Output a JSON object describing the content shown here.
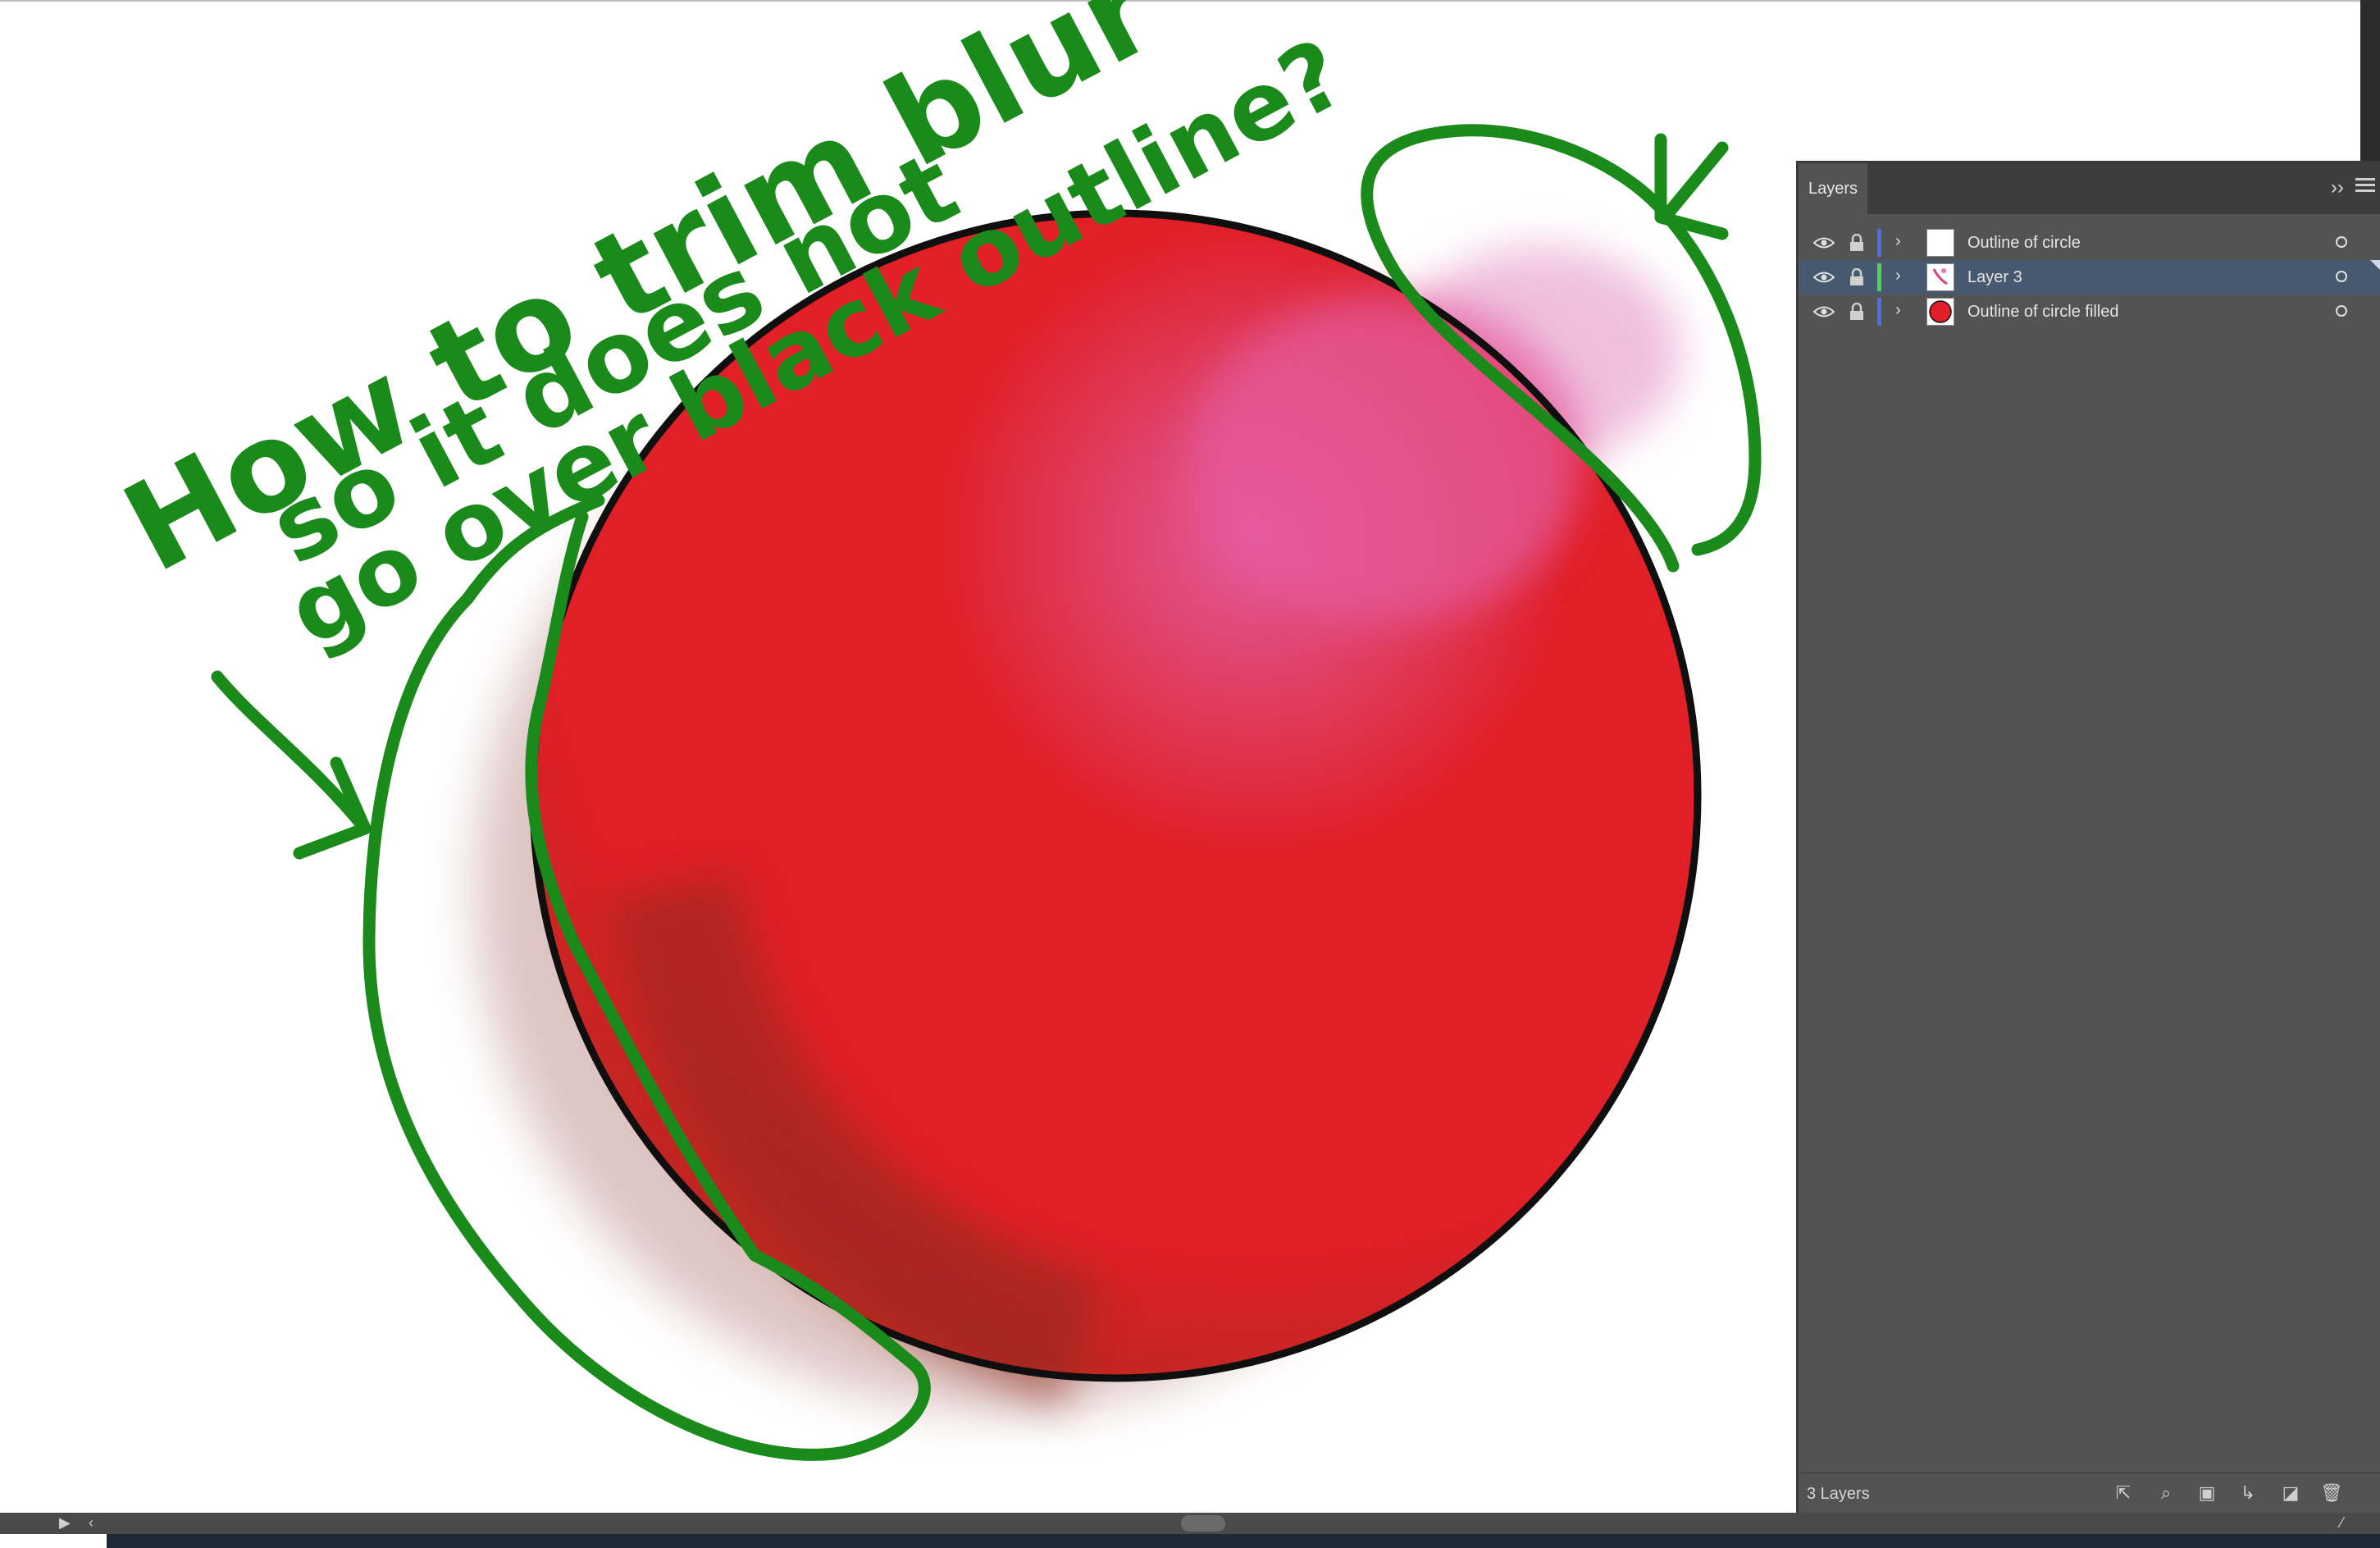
{
  "annotation": {
    "lines": [
      "How to trim blur",
      "so it does not",
      "go over black outline?"
    ]
  },
  "layers_panel": {
    "tab_label": "Layers",
    "collapse_icon": "double-chevron-right-icon",
    "menu_icon": "hamburger-menu-icon",
    "layers": [
      {
        "name": "Outline of circle",
        "color": "#4b6fe8",
        "visible": true,
        "selected": false,
        "thumbnail": "white"
      },
      {
        "name": "Layer 3",
        "color": "#4cd84c",
        "visible": true,
        "selected": true,
        "thumbnail": "pink-stroke"
      },
      {
        "name": "Outline of circle filled",
        "color": "#4b6fe8",
        "visible": true,
        "selected": false,
        "thumbnail": "red-circle"
      }
    ],
    "footer": {
      "layer_count": "3 Layers",
      "icons": [
        "export-icon",
        "locate-object-icon",
        "make-clipping-mask-icon",
        "create-sublayer-icon",
        "new-layer-icon",
        "delete-icon"
      ]
    }
  },
  "colors": {
    "ball_red": "#e01f27",
    "ball_shadow": "#962a1f",
    "highlight_pink": "#e05a9a",
    "annotation_green": "#1a8a1a",
    "selected_row": "#46596e"
  }
}
